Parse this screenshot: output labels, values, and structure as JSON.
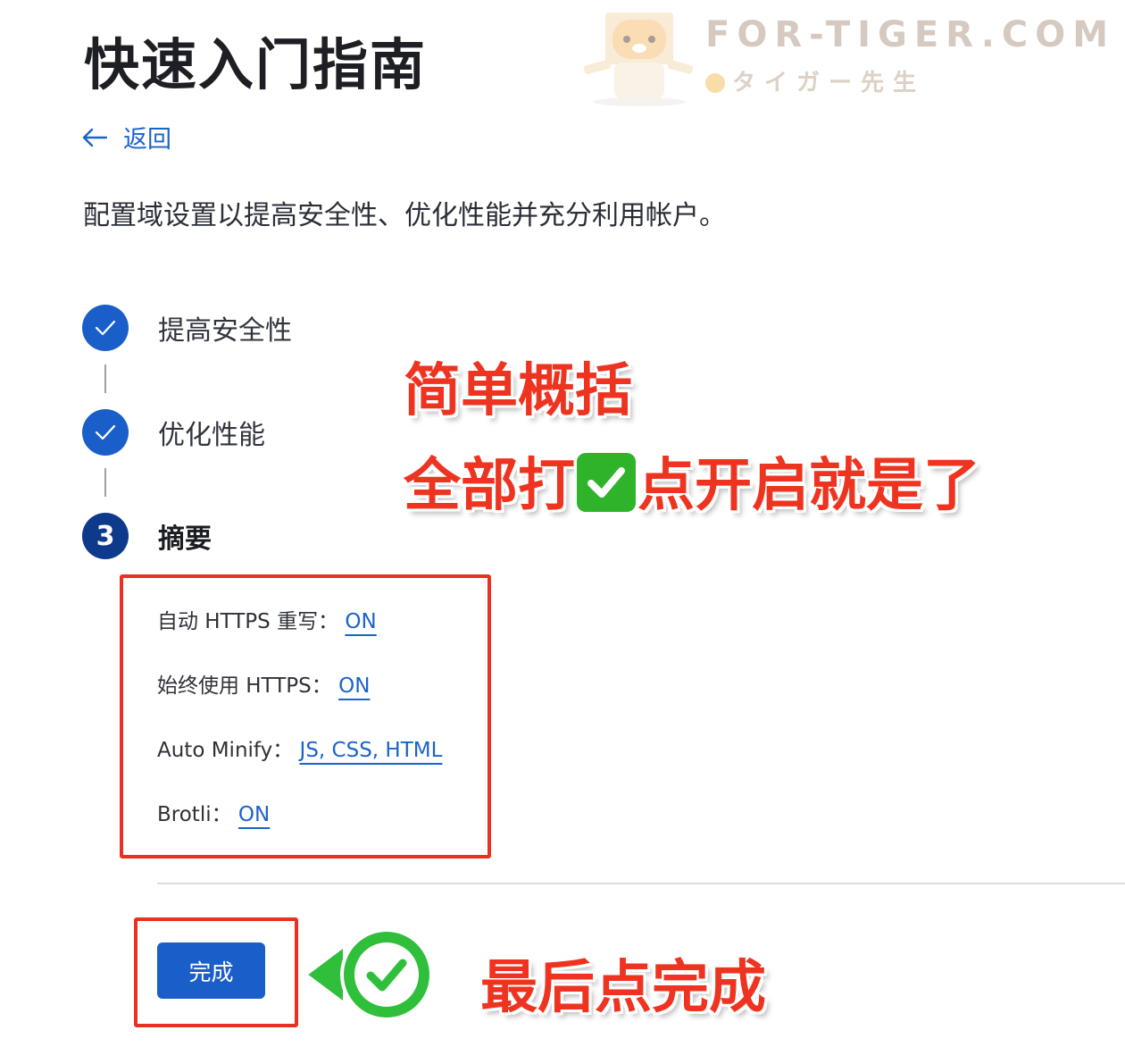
{
  "page": {
    "title": "快速入门指南",
    "back_label": "返回",
    "description": "配置域设置以提高安全性、优化性能并充分利用帐户。"
  },
  "watermark": {
    "domain": "FOR-TIGER.COM",
    "subtitle": "タイガー先生"
  },
  "steps": [
    {
      "number": "1",
      "label": "提高安全性",
      "state": "completed",
      "icon": "check-icon"
    },
    {
      "number": "2",
      "label": "优化性能",
      "state": "completed",
      "icon": "check-icon"
    },
    {
      "number": "3",
      "label": "摘要",
      "state": "current"
    }
  ],
  "summary": {
    "rows": [
      {
        "label": "自动 HTTPS 重写：",
        "value": "ON"
      },
      {
        "label": "始终使用 HTTPS：",
        "value": "ON"
      },
      {
        "label": "Auto Minify：",
        "value": "JS, CSS, HTML"
      },
      {
        "label": "Brotli：",
        "value": "ON"
      }
    ]
  },
  "actions": {
    "done_label": "完成"
  },
  "annotations": {
    "line1": "简单概括",
    "line2_before": "全部打",
    "line2_after": "点开启就是了",
    "line3": "最后点完成",
    "highlight_color": "#e8311f",
    "check_emoji_color": "#2fb32a"
  },
  "colors": {
    "accent": "#1a5fc9",
    "link": "#1c63c9",
    "current_step": "#0d3a8a"
  }
}
